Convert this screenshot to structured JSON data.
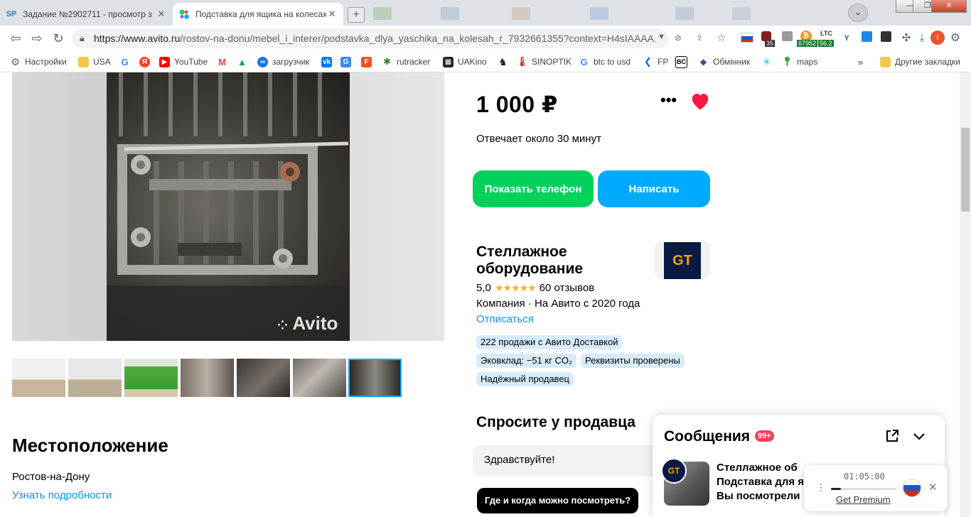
{
  "browser": {
    "tabs": [
      {
        "title": "Задание №2902711 - просмотр з",
        "favicon": "SP"
      },
      {
        "title": "Подставка для ящика на колесах",
        "favicon": "avito"
      }
    ],
    "new_tab_label": "+",
    "window_controls": {
      "minimize": "—",
      "restore": "❐",
      "close": "✕"
    },
    "url_base": "https://www.avito.ru",
    "url_path": "/rostov-na-donu/mebel_i_interer/podstavka_dlya_yaschika_na_kolesah_r_7932661355?context=H4sIAAAA...",
    "extensions": {
      "badge_35": "35",
      "badge_btc": "67952",
      "ltc_label": "LTC",
      "ltc_value": "56.2",
      "profile_letter": "I"
    },
    "bookmarks": [
      {
        "label": "Настройки",
        "icon": "gear-icon"
      },
      {
        "label": "USA",
        "icon": "folder-icon"
      },
      {
        "label": "",
        "icon": "google-icon"
      },
      {
        "label": "",
        "icon": "yandex-icon"
      },
      {
        "label": "YouTube",
        "icon": "youtube-icon"
      },
      {
        "label": "",
        "icon": "gmail-icon"
      },
      {
        "label": "",
        "icon": "drive-icon"
      },
      {
        "label": "загрузчик",
        "icon": "loader-icon"
      },
      {
        "label": "",
        "icon": "vk-icon"
      },
      {
        "label": "",
        "icon": "translate-icon"
      },
      {
        "label": "",
        "icon": "f-icon"
      },
      {
        "label": "rutracker",
        "icon": "rutracker-icon"
      },
      {
        "label": "UAKino",
        "icon": "uakino-icon"
      },
      {
        "label": "",
        "icon": "chess-icon"
      },
      {
        "label": "SINOPTIK",
        "icon": "sinoptik-icon"
      },
      {
        "label": "btc to usd",
        "icon": "google-icon"
      },
      {
        "label": "FP",
        "icon": "fp-icon"
      },
      {
        "label": "",
        "icon": "bc-icon"
      },
      {
        "label": "Обмінник",
        "icon": "exchange-icon"
      },
      {
        "label": "",
        "icon": "snowflake-icon"
      },
      {
        "label": "maps",
        "icon": "maps-icon"
      }
    ],
    "bookmarks_overflow": "»",
    "other_bookmarks": "Другие закладки"
  },
  "listing": {
    "price": "1 000 ₽",
    "responds": "Отвечает около 30 минут",
    "show_phone": "Показать телефон",
    "write": "Написать",
    "watermark": "Avito",
    "thumbnail_count": 7,
    "selected_thumbnail": 7
  },
  "seller": {
    "name": "Стеллажное оборудование",
    "logo_text": "GT",
    "rating": "5,0",
    "stars": "★★★★★",
    "reviews": "60 отзывов",
    "company": "Компания · На Авито с 2020 года",
    "unsubscribe": "Отписаться",
    "badges": [
      "222 продажи с Авито Доставкой",
      "Эковклад: −51 кг CO₂",
      "Реквизиты проверены",
      "Надёжный продавец"
    ]
  },
  "location": {
    "heading": "Местоположение",
    "city": "Ростов-на-Дону",
    "more": "Узнать подробности"
  },
  "ask": {
    "title": "Спросите у продавца",
    "input_value": "Здравствуйте!",
    "quick_question": "Где и когда можно посмотреть?"
  },
  "messages": {
    "title": "Сообщения",
    "count": "99+",
    "lines": [
      "Стеллажное об",
      "Подставка для я",
      "Вы посмотрели"
    ]
  },
  "player": {
    "time": "01:05:00",
    "progress": 0.15,
    "premium": "Get Premium",
    "menu": "⋮",
    "close": "✕"
  },
  "colors": {
    "accent_green": "#02d15c",
    "accent_blue": "#00aaff",
    "link": "#0099f7",
    "heart": "#ff4053"
  }
}
